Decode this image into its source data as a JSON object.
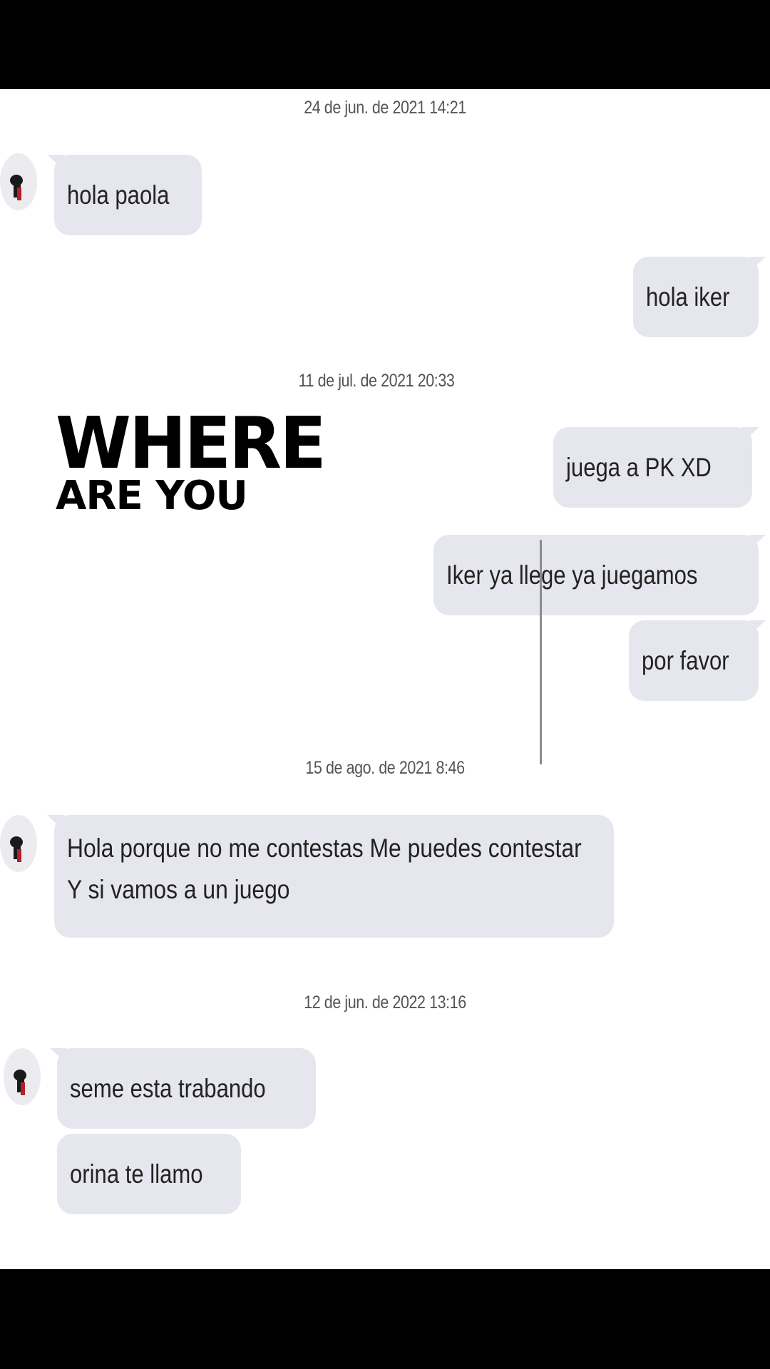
{
  "messages": [
    {
      "type": "timestamp",
      "text": "24 de jun. de 2021 14:21"
    },
    {
      "type": "in",
      "text": "hola paola"
    },
    {
      "type": "out",
      "text": "hola iker"
    },
    {
      "type": "timestamp",
      "text": "11 de jul. de 2021 20:33"
    },
    {
      "type": "out",
      "text": "juega a PK XD"
    },
    {
      "type": "out",
      "text": "Iker ya llege ya juegamos"
    },
    {
      "type": "out",
      "text": "por favor"
    },
    {
      "type": "timestamp",
      "text": "15 de ago. de 2021 8:46"
    },
    {
      "type": "in",
      "text": "Hola porque no me contestas Me puedes contestar Y si vamos a un juego"
    },
    {
      "type": "timestamp",
      "text": "12 de jun. de 2022 13:16"
    },
    {
      "type": "in",
      "text": "seme esta trabando"
    },
    {
      "type": "in",
      "text": "orina te llamo"
    }
  ],
  "overlay": {
    "line1": "WHERE",
    "line2": "ARE YOU"
  },
  "colors": {
    "bubble": "#e6e6ee",
    "background": "#ffffff",
    "frame": "#000000",
    "timestamp": "#555555"
  },
  "icons": {
    "avatar": "user-avatar-icon"
  }
}
